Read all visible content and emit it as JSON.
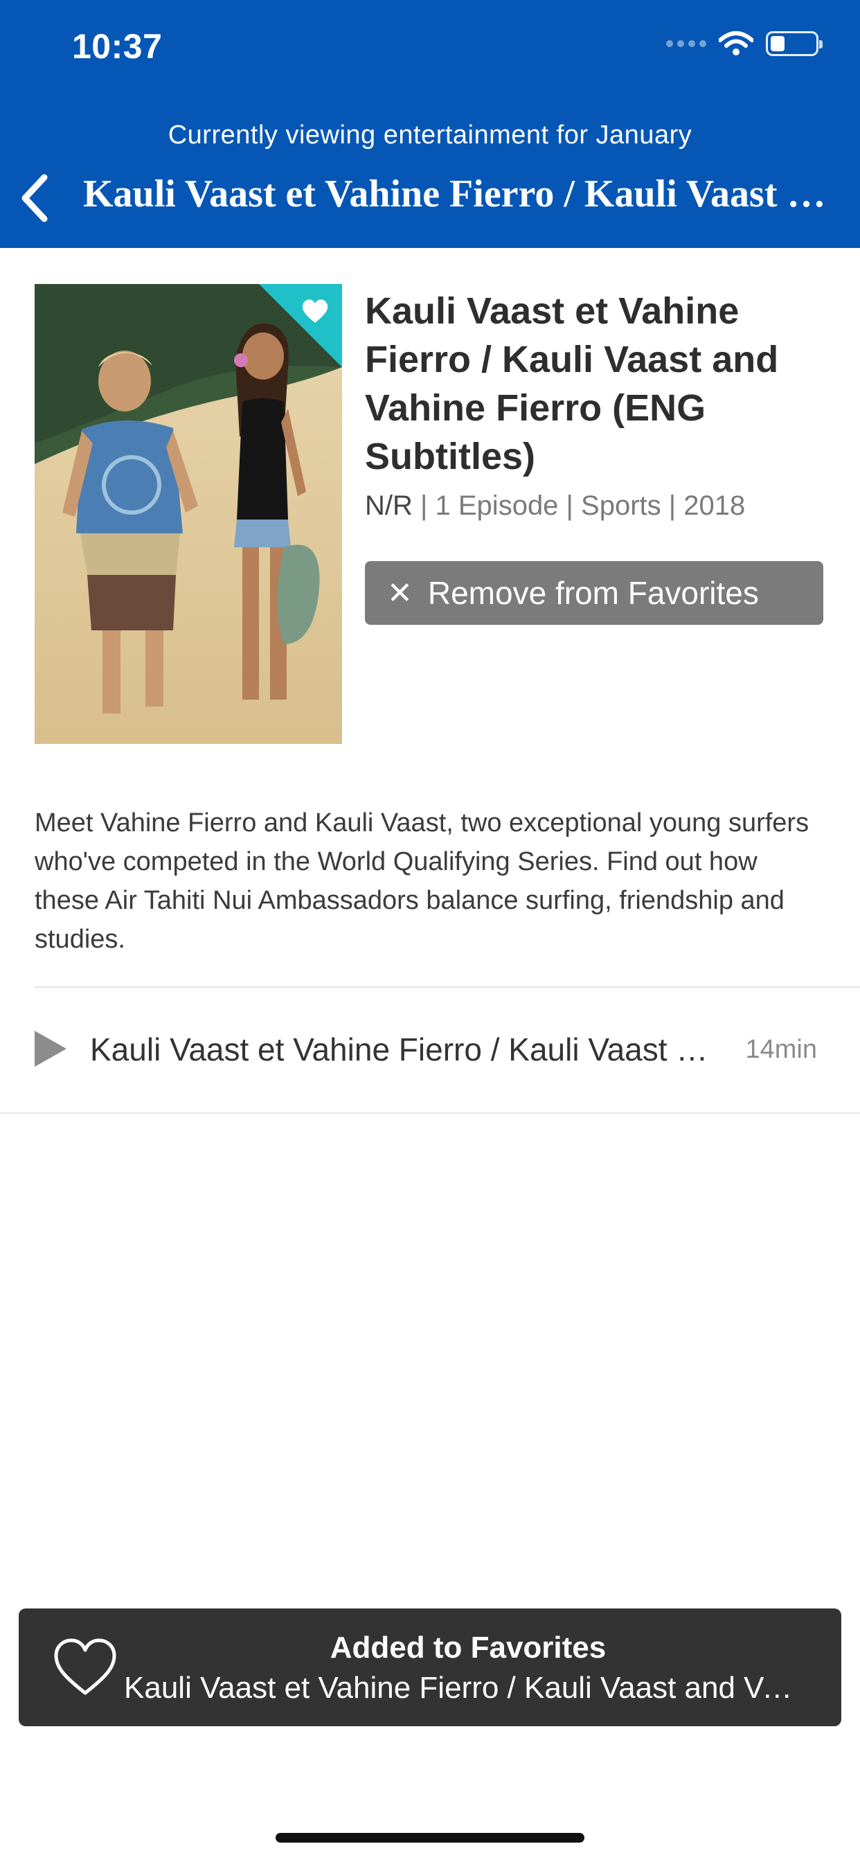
{
  "status_bar": {
    "time": "10:37",
    "icons": [
      "cellular-signal-icon",
      "wifi-icon",
      "battery-icon"
    ]
  },
  "header": {
    "viewing_note": "Currently viewing entertainment for January",
    "nav_title": "Kauli Vaast et Vahine Fierro / Kauli Vaast and Vahine Fierro (ENG Subtitles)",
    "back_icon": "chevron-left-icon",
    "background_color": "#0657b5"
  },
  "detail": {
    "poster_description_icon": "heart-icon",
    "title": "Kauli Vaast et Vahine Fierro / Kauli Vaast and Vahine Fierro (ENG Subtitles)",
    "rating": "N/R",
    "meta": "| 1 Episode | Sports | 2018",
    "remove_button_label": "Remove from Favorites",
    "remove_button_icon": "close-icon",
    "accent_color": "#20c0c8"
  },
  "description": "Meet Vahine Fierro and Kauli Vaast, two exceptional young surfers who've competed in the World Qualifying Series. Find out how these Air Tahiti Nui Ambassadors balance surfing, friendship and studies.",
  "episodes": [
    {
      "title": "Kauli Vaast et Vahine Fierro / Kauli Vaast and Vahine Fierro",
      "duration": "14min",
      "icon": "play-icon"
    }
  ],
  "toast": {
    "heading": "Added to Favorites",
    "subtitle": "Kauli Vaast et Vahine Fierro / Kauli Vaast and Vahine Fierro",
    "icon": "heart-outline-icon"
  }
}
